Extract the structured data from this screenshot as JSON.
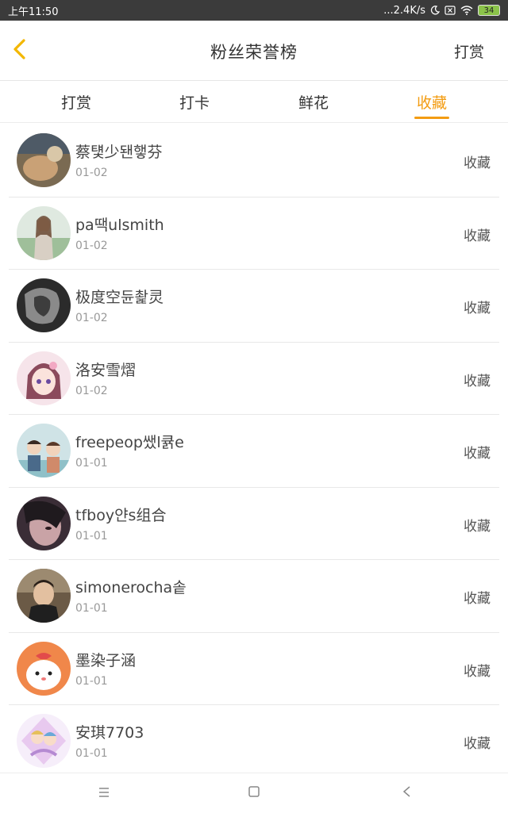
{
  "status_bar": {
    "time": "上午11:50",
    "network_speed": "...2.4K/s",
    "battery": "34",
    "icons": [
      "moon-icon",
      "sim-off-icon",
      "wifi-icon",
      "battery-icon"
    ]
  },
  "header": {
    "title": "粉丝荣誉榜",
    "right_button": "打赏",
    "back_icon": "chevron-left-icon"
  },
  "tabs": [
    {
      "label": "打赏",
      "active": false
    },
    {
      "label": "打卡",
      "active": false
    },
    {
      "label": "鲜花",
      "active": false
    },
    {
      "label": "收藏",
      "active": true
    }
  ],
  "colors": {
    "accent": "#f39c12",
    "status_bar": "#3b3b3b",
    "text_primary": "#444444",
    "text_secondary": "#999999"
  },
  "fans": [
    {
      "name": "蔡턫少됀햏芬",
      "date": "01-02",
      "action": "收藏"
    },
    {
      "name": "pa땍ulsmith",
      "date": "01-02",
      "action": "收藏"
    },
    {
      "name": "极度空듄촱灵",
      "date": "01-02",
      "action": "收藏"
    },
    {
      "name": "洛安雪熠",
      "date": "01-02",
      "action": "收藏"
    },
    {
      "name": "freepeop쌨l큙e",
      "date": "01-01",
      "action": "收藏"
    },
    {
      "name": "tfboy얀s组合",
      "date": "01-01",
      "action": "收藏"
    },
    {
      "name": "simonerocha솥",
      "date": "01-01",
      "action": "收藏"
    },
    {
      "name": "墨染子涵",
      "date": "01-01",
      "action": "收藏"
    },
    {
      "name": "安琪7703",
      "date": "01-01",
      "action": "收藏"
    }
  ],
  "nav_bar": {
    "icons": [
      "menu-icon",
      "home-square-icon",
      "back-triangle-icon"
    ]
  }
}
